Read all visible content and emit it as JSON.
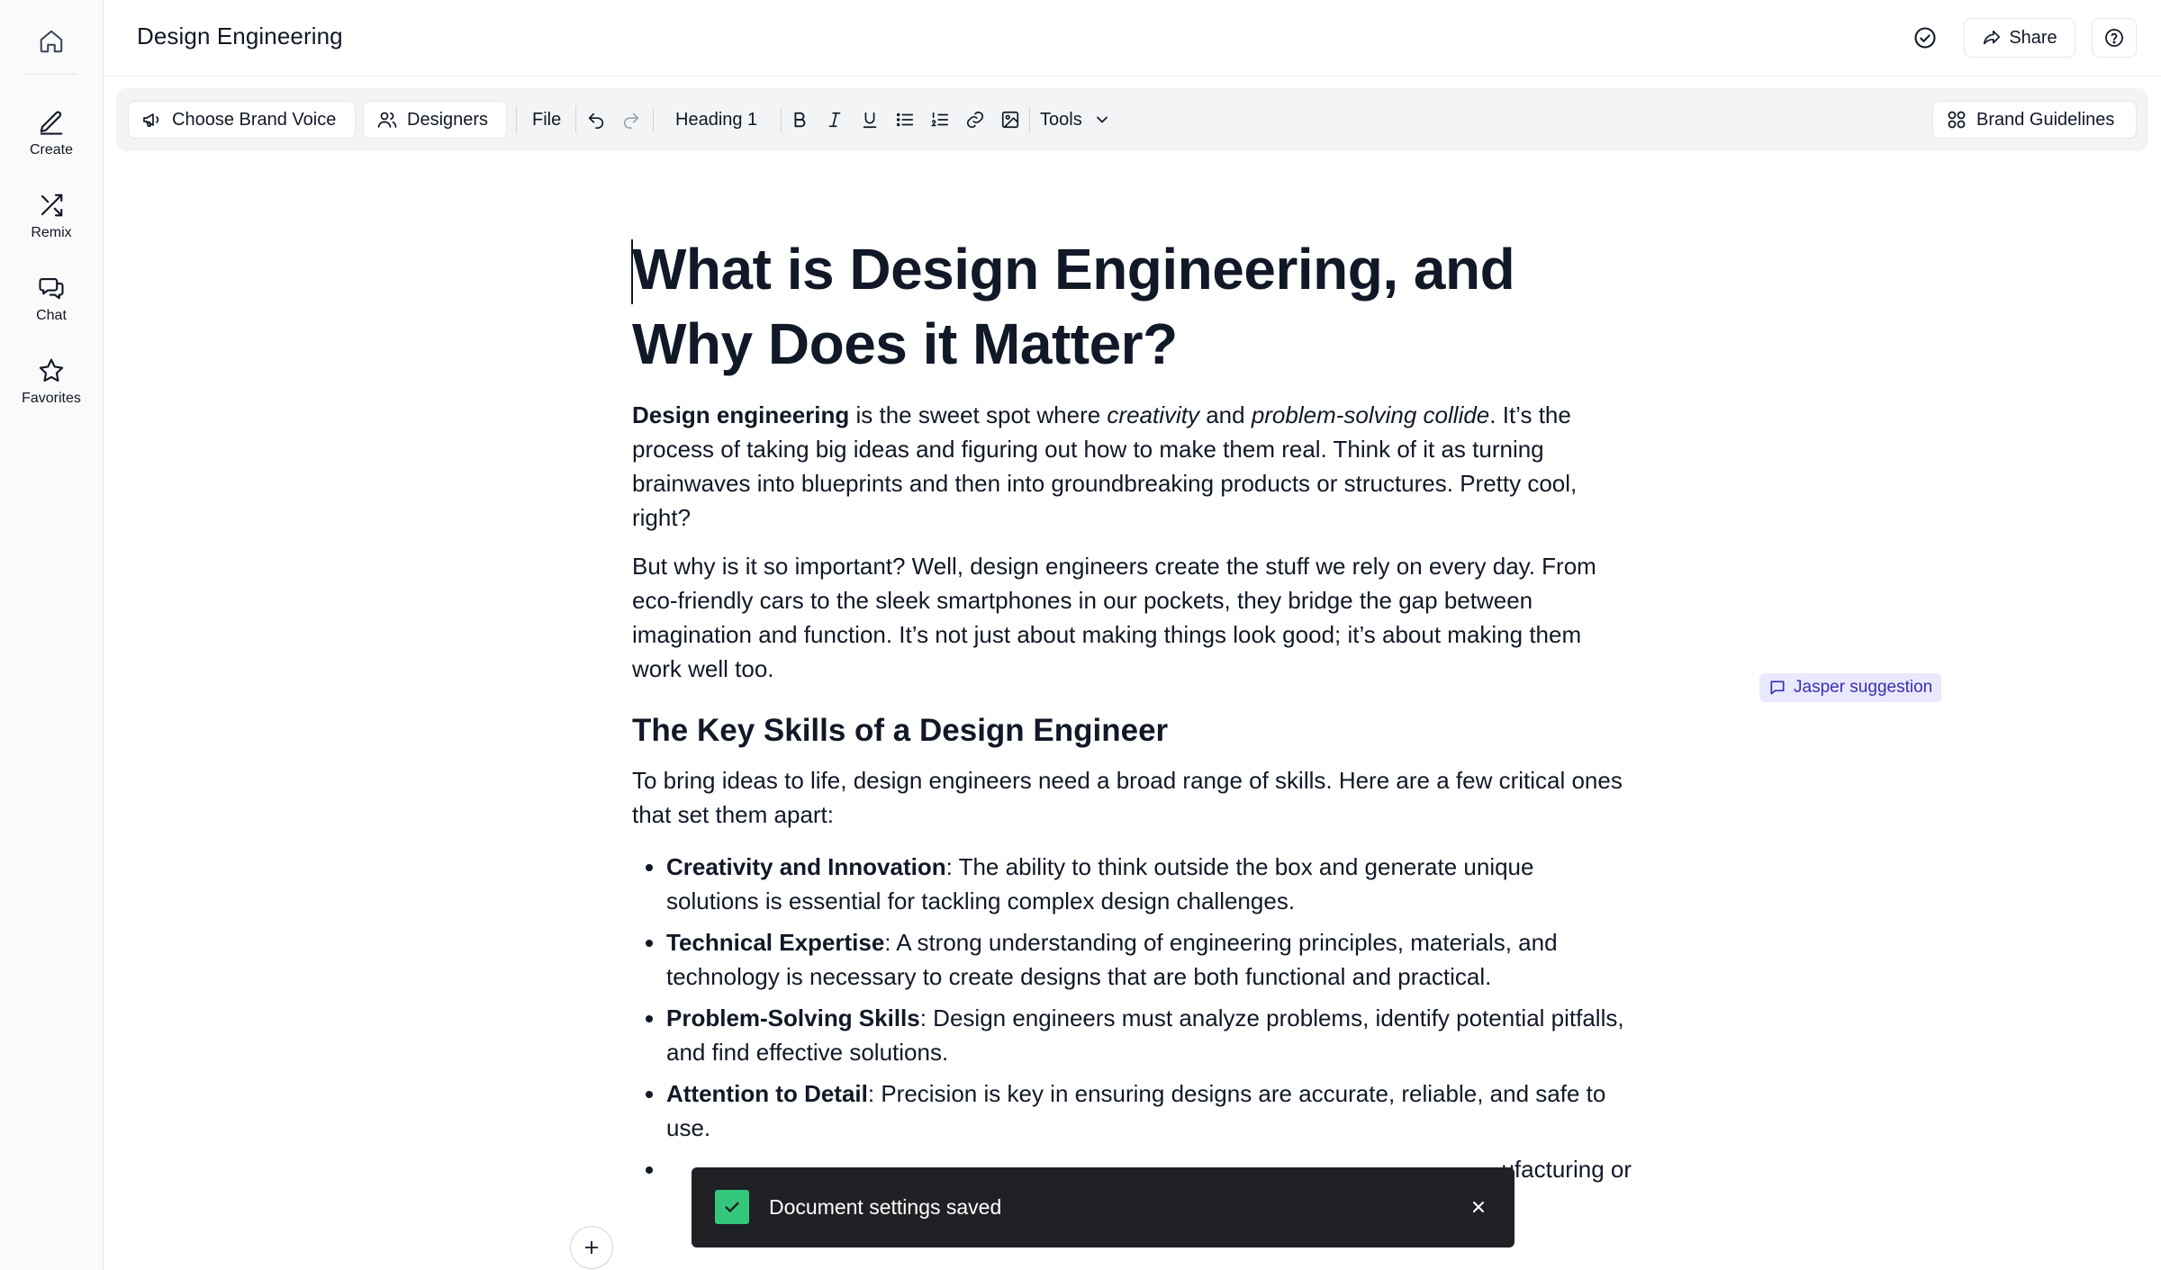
{
  "sidebar": {
    "items": [
      {
        "label": "Create",
        "icon": "pen-icon"
      },
      {
        "label": "Remix",
        "icon": "shuffle-icon"
      },
      {
        "label": "Chat",
        "icon": "chat-icon"
      },
      {
        "label": "Favorites",
        "icon": "star-icon"
      }
    ]
  },
  "header": {
    "title": "Design Engineering",
    "share_label": "Share"
  },
  "toolbar": {
    "brand_voice_label": "Choose Brand Voice",
    "audience_label": "Designers",
    "file_label": "File",
    "heading_label": "Heading 1",
    "tools_label": "Tools",
    "brand_guidelines_label": "Brand Guidelines"
  },
  "document": {
    "title": "What is Design Engineering, and Why Does it Matter?",
    "p1": {
      "b1": "Design engineering",
      "t1": " is the sweet spot where ",
      "i1": "creativity",
      "t2": " and ",
      "i2": "problem-solving collide",
      "t3": ". It’s the process of taking big ideas and figuring out how to make them real. Think of it as turning brainwaves into blueprints and then into groundbreaking products or structures. Pretty cool, right?"
    },
    "p2": "But why is it so important? Well, design engineers create the stuff we rely on every day. From eco-friendly cars to the sleek smartphones in our pockets, they bridge the gap between imagination and function. It’s not just about making things look good; it’s about making them work well too.",
    "h2": "The Key Skills of a Design Engineer",
    "p3": "To bring ideas to life, design engineers need a broad range of skills. Here are a few critical ones that set them apart:",
    "bullets": [
      {
        "term": "Creativity and Innovation",
        "desc": ": The ability to think outside the box and generate unique solutions is essential for tackling complex design challenges."
      },
      {
        "term": "Technical Expertise",
        "desc": ": A strong understanding of engineering principles, materials, and technology is necessary to create designs that are both functional and practical."
      },
      {
        "term": "Problem-Solving Skills",
        "desc": ": Design engineers must analyze problems, identify potential pitfalls, and find effective solutions."
      },
      {
        "term": "Attention to Detail",
        "desc": ": Precision is key in ensuring designs are accurate, reliable, and safe to use."
      },
      {
        "term": "",
        "desc": "ufacturing or"
      }
    ]
  },
  "suggestion_label": "Jasper suggestion",
  "toast": {
    "message": "Document settings saved"
  },
  "colors": {
    "toast_bg": "#1f2124",
    "toast_check": "#34c77b",
    "suggestion_bg": "#eae8fd",
    "suggestion_text": "#3b2fb0"
  }
}
